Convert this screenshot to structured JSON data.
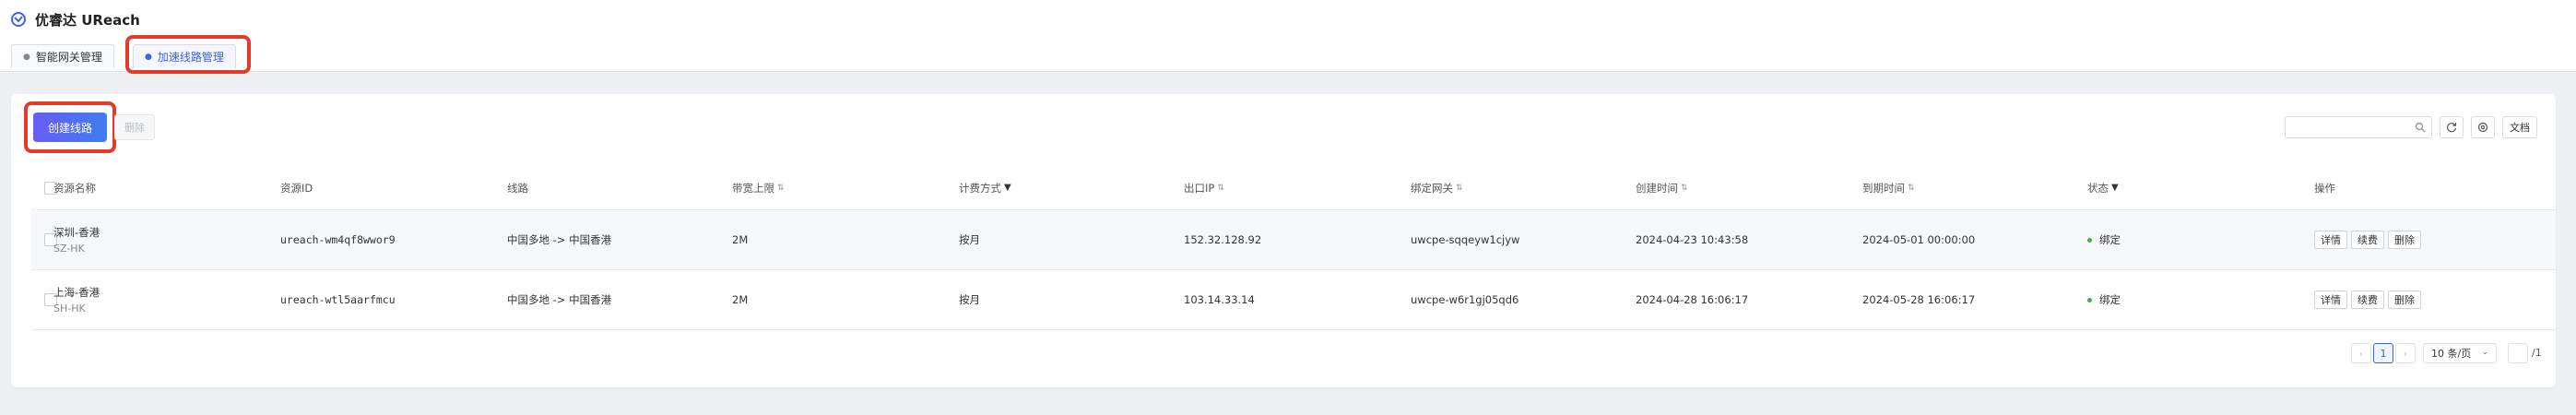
{
  "app": {
    "title": "优睿达 UReach",
    "brand_color": "#3b63e6"
  },
  "tabs": [
    {
      "label": "智能网关管理",
      "active": false
    },
    {
      "label": "加速线路管理",
      "active": true
    }
  ],
  "toolbar": {
    "create_label": "创建线路",
    "delete_label": "删除",
    "search_placeholder": "",
    "docs_label": "文档"
  },
  "table": {
    "columns": [
      {
        "label": "资源名称"
      },
      {
        "label": "资源ID"
      },
      {
        "label": "线路"
      },
      {
        "label": "带宽上限",
        "sortable": true
      },
      {
        "label": "计费方式",
        "filterable": true
      },
      {
        "label": "出口IP",
        "sortable": true
      },
      {
        "label": "绑定网关",
        "sortable": true
      },
      {
        "label": "创建时间",
        "sortable": true
      },
      {
        "label": "到期时间",
        "sortable": true
      },
      {
        "label": "状态",
        "filterable": true
      },
      {
        "label": "操作"
      }
    ],
    "rows": [
      {
        "name": "深圳-香港",
        "code": "SZ-HK",
        "id": "ureach-wm4qf8wwor9",
        "route": "中国多地 -> 中国香港",
        "bandwidth": "2M",
        "billing": "按月",
        "egress_ip": "152.32.128.92",
        "gateway": "uwcpe-sqqeyw1cjyw",
        "created": "2024-04-23 10:43:58",
        "expires": "2024-05-01 00:00:00",
        "status": "绑定",
        "actions": [
          "详情",
          "续费",
          "删除"
        ]
      },
      {
        "name": "上海-香港",
        "code": "SH-HK",
        "id": "ureach-wtl5aarfmcu",
        "route": "中国多地 -> 中国香港",
        "bandwidth": "2M",
        "billing": "按月",
        "egress_ip": "103.14.33.14",
        "gateway": "uwcpe-w6r1gj05qd6",
        "created": "2024-04-28 16:06:17",
        "expires": "2024-05-28 16:06:17",
        "status": "绑定",
        "actions": [
          "详情",
          "续费",
          "删除"
        ]
      }
    ]
  },
  "pagination": {
    "prev": "‹",
    "current_page": "1",
    "next": "›",
    "page_size": "10 条/页",
    "total_pages": "/1"
  },
  "status_color": "#3ab24e",
  "highlight_color": "#e53a2a"
}
